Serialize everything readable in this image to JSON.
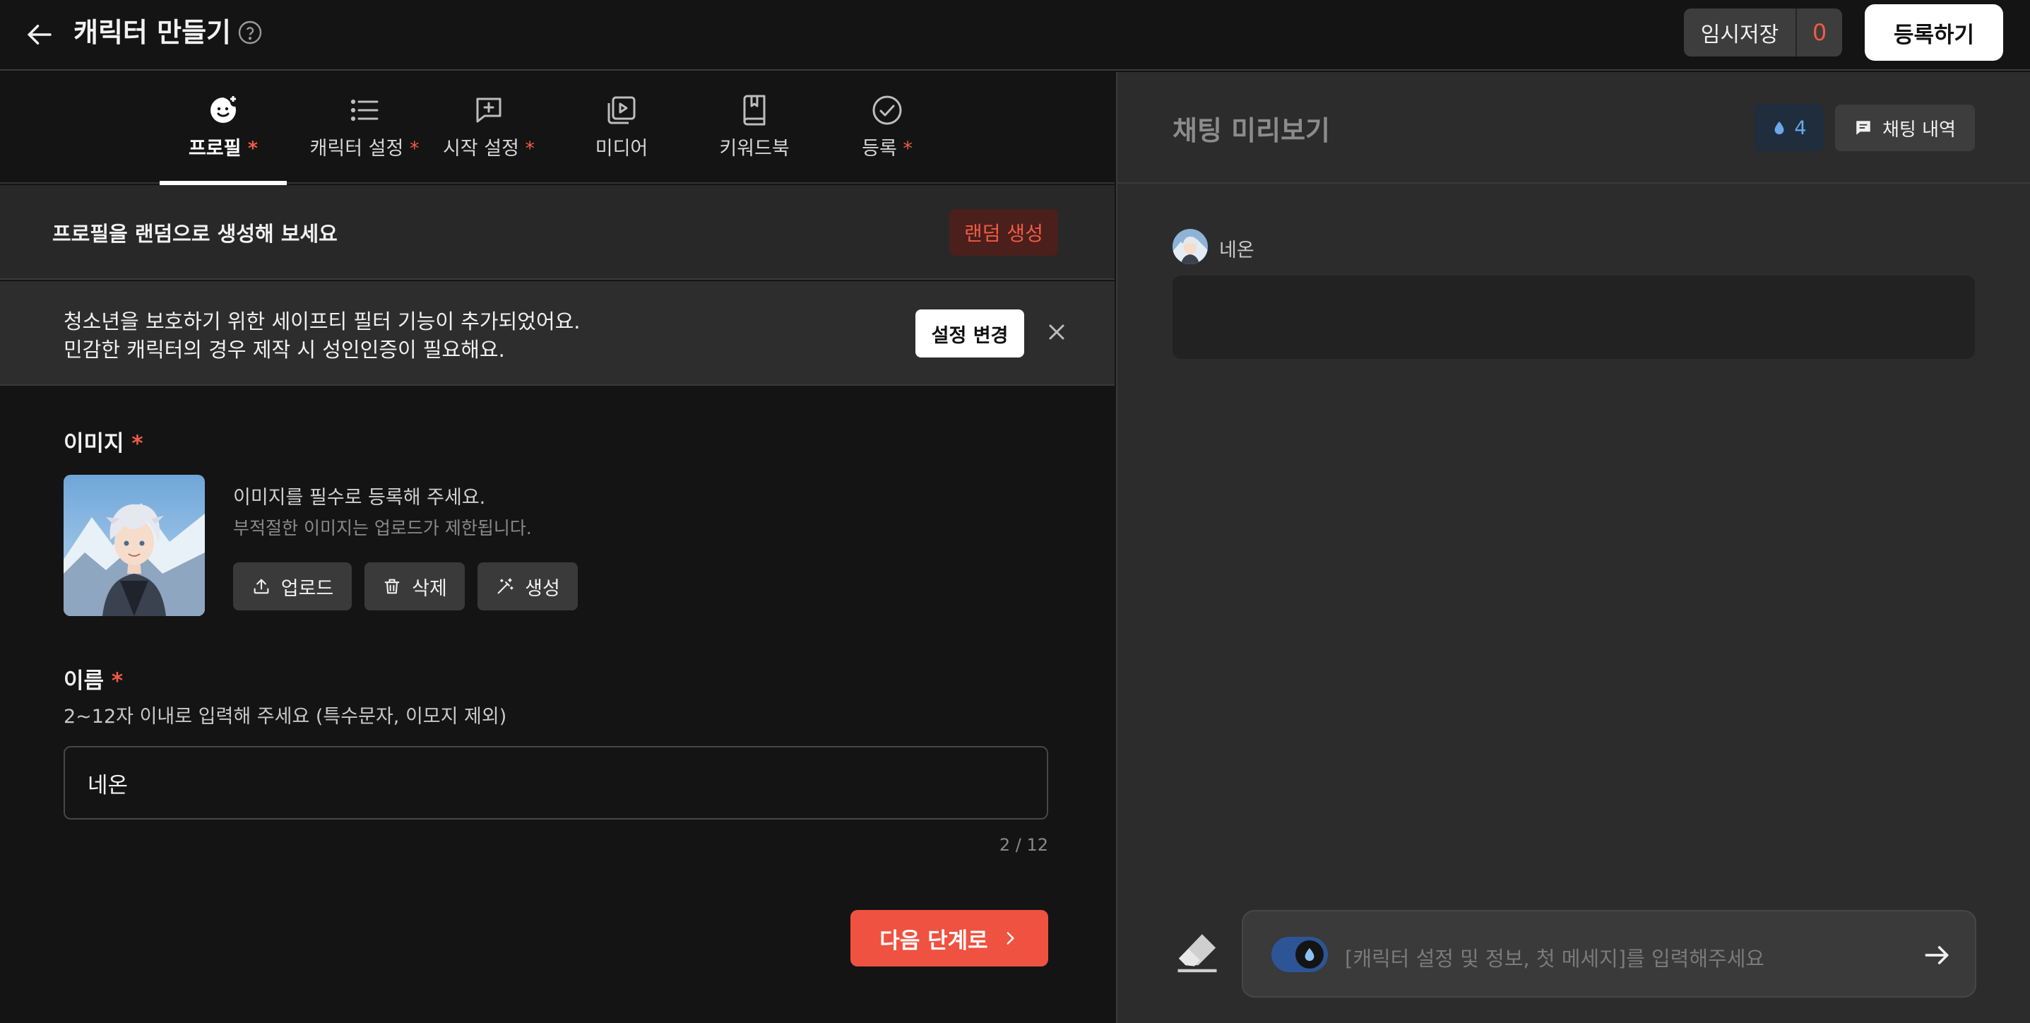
{
  "header": {
    "title": "캐릭터 만들기",
    "save_label": "임시저장",
    "save_count": "0",
    "register_label": "등록하기"
  },
  "tabs": [
    {
      "label": "프로필",
      "required": "*",
      "icon": "profile-smile-icon",
      "active": true
    },
    {
      "label": "캐릭터 설정",
      "required": "*",
      "icon": "list-icon"
    },
    {
      "label": "시작 설정",
      "required": "*",
      "icon": "chat-plus-icon"
    },
    {
      "label": "미디어",
      "required": "",
      "icon": "media-play-icon"
    },
    {
      "label": "키워드북",
      "required": "",
      "icon": "book-icon"
    },
    {
      "label": "등록",
      "required": "*",
      "icon": "check-circle-icon"
    }
  ],
  "random": {
    "text": "프로필을 랜덤으로 생성해 보세요",
    "button": "랜덤 생성"
  },
  "notice": {
    "line1": "청소년을 보호하기 위한 세이프티 필터 기능이 추가되었어요.",
    "line2": "민감한 캐릭터의 경우 제작 시 성인인증이 필요해요.",
    "button": "설정 변경"
  },
  "image": {
    "label": "이미지",
    "required": "*",
    "hint": "이미지를 필수로 등록해 주세요.",
    "subhint": "부적절한 이미지는 업로드가 제한됩니다.",
    "upload": "업로드",
    "delete": "삭제",
    "generate": "생성"
  },
  "name": {
    "label": "이름",
    "required": "*",
    "hint": "2~12자 이내로 입력해 주세요 (특수문자, 이모지 제외)",
    "value": "네온",
    "count": "2 / 12"
  },
  "next_label": "다음 단계로",
  "preview": {
    "title": "채팅 미리보기",
    "drop_count": "4",
    "history_label": "채팅 내역",
    "char_name": "네온",
    "composer_placeholder": "[캐릭터 설정 및 정보, 첫 메세지]를 입력해주세요"
  },
  "colors": {
    "accent": "#ef5240",
    "toggle": "#2d5596",
    "drop": "#6aa8ea"
  }
}
